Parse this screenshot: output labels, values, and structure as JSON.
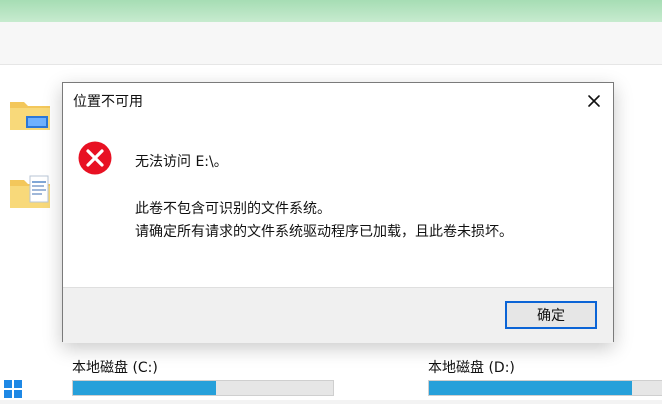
{
  "dialog": {
    "title": "位置不可用",
    "message_line1": "无法访问 E:\\。",
    "message_line2": "此卷不包含可识别的文件系统。",
    "message_line3": "请确定所有请求的文件系统驱动程序已加载，且此卷未损坏。",
    "ok_label": "确定",
    "accent_color": "#0b64d6",
    "error_color": "#e81123"
  },
  "drives": [
    {
      "label": "本地磁盘 (C:)",
      "used_fraction": 0.55
    },
    {
      "label": "本地磁盘 (D:)",
      "used_fraction": 0.78
    }
  ],
  "icons": {
    "error": "error-icon",
    "close": "close-icon",
    "folder": "folder-icon",
    "document": "document-icon",
    "windows": "windows-icon"
  }
}
